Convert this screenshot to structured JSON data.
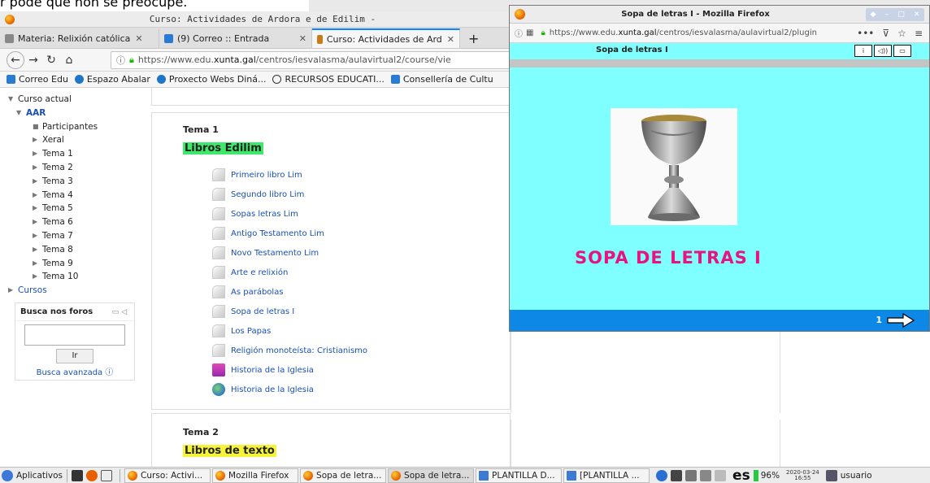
{
  "caption": "r pode que non se preocupe.",
  "main_window": {
    "title": "Curso: Actividades de Ardora e de Edilim -",
    "tabs": [
      {
        "label": "Materia: Relixión católica",
        "active": false
      },
      {
        "label": "(9) Correo :: Entrada",
        "active": false
      },
      {
        "label": "Curso: Actividades de Ard",
        "active": true
      }
    ],
    "new_tab": "+",
    "tab_close": "✕",
    "url_prefix": "https://www.edu.",
    "url_domain": "xunta.gal",
    "url_suffix": "/centros/iesvalasma/aulavirtual2/course/vie",
    "bookmarks": [
      "Correo Edu",
      "Espazo Abalar",
      "Proxecto Webs Diná...",
      "RECURSOS EDUCATI...",
      "Consellería de Cultu"
    ]
  },
  "sidebar": {
    "current_course": "Curso actual",
    "course_short": "AAR",
    "items": [
      "Participantes",
      "Xeral",
      "Tema 1",
      "Tema 2",
      "Tema 3",
      "Tema 4",
      "Tema 5",
      "Tema 6",
      "Tema 7",
      "Tema 8",
      "Tema 9",
      "Tema 10"
    ],
    "courses": "Cursos"
  },
  "search_block": {
    "title": "Busca nos foros",
    "button": "Ir",
    "advanced": "Busca avanzada"
  },
  "section1": {
    "title": "Tema 1",
    "highlight": "Libros Edilim",
    "links": [
      {
        "label": "Primeiro libro Lim",
        "icon": "doc"
      },
      {
        "label": "Segundo libro Lim",
        "icon": "doc"
      },
      {
        "label": "Sopas letras Lim",
        "icon": "doc"
      },
      {
        "label": "Antigo Testamento Lim",
        "icon": "doc"
      },
      {
        "label": "Novo Testamento Lim",
        "icon": "doc"
      },
      {
        "label": "Arte e relixión",
        "icon": "doc"
      },
      {
        "label": "As parábolas",
        "icon": "doc"
      },
      {
        "label": "Sopa de letras I",
        "icon": "doc"
      },
      {
        "label": "Los Papas",
        "icon": "doc"
      },
      {
        "label": "Religión monoteísta: Cristianismo",
        "icon": "doc"
      },
      {
        "label": "Historia de la Iglesia",
        "icon": "book"
      },
      {
        "label": "Historia de la Iglesia",
        "icon": "globe"
      }
    ]
  },
  "section2": {
    "title": "Tema 2",
    "highlight": "Libros de texto"
  },
  "popup": {
    "title": "Sopa de letras I - Mozilla Firefox",
    "url_prefix": "https://www.edu.",
    "url_domain": "xunta.gal",
    "url_suffix": "/centros/iesvalasma/aulavirtual2/plugin",
    "header_title": "Sopa de letras I",
    "big_title": "SOPA DE LETRAS I",
    "page_number": "1"
  },
  "taskbar": {
    "apps_label": "Aplicativos",
    "tasks": [
      {
        "label": "Curso: Activi...",
        "icon": "firefox"
      },
      {
        "label": "Mozilla Firefox",
        "icon": "firefox"
      },
      {
        "label": "Sopa de letra...",
        "icon": "firefox"
      },
      {
        "label": "Sopa de letra...",
        "icon": "firefox"
      },
      {
        "label": "PLANTILLA D...",
        "icon": "doc"
      },
      {
        "label": "[PLANTILLA ...",
        "icon": "doc"
      }
    ],
    "lang": "es",
    "battery": "96%",
    "date": "2020-03-24",
    "time": "16:55",
    "user": "usuario"
  },
  "colors": {
    "popup_bg": "#7fffff",
    "popup_title": "#e8137f",
    "popup_bar": "#0d88e6",
    "highlight_green": "#3fe86a",
    "highlight_yellow": "#f6f33a",
    "link": "#1a4fb8"
  }
}
